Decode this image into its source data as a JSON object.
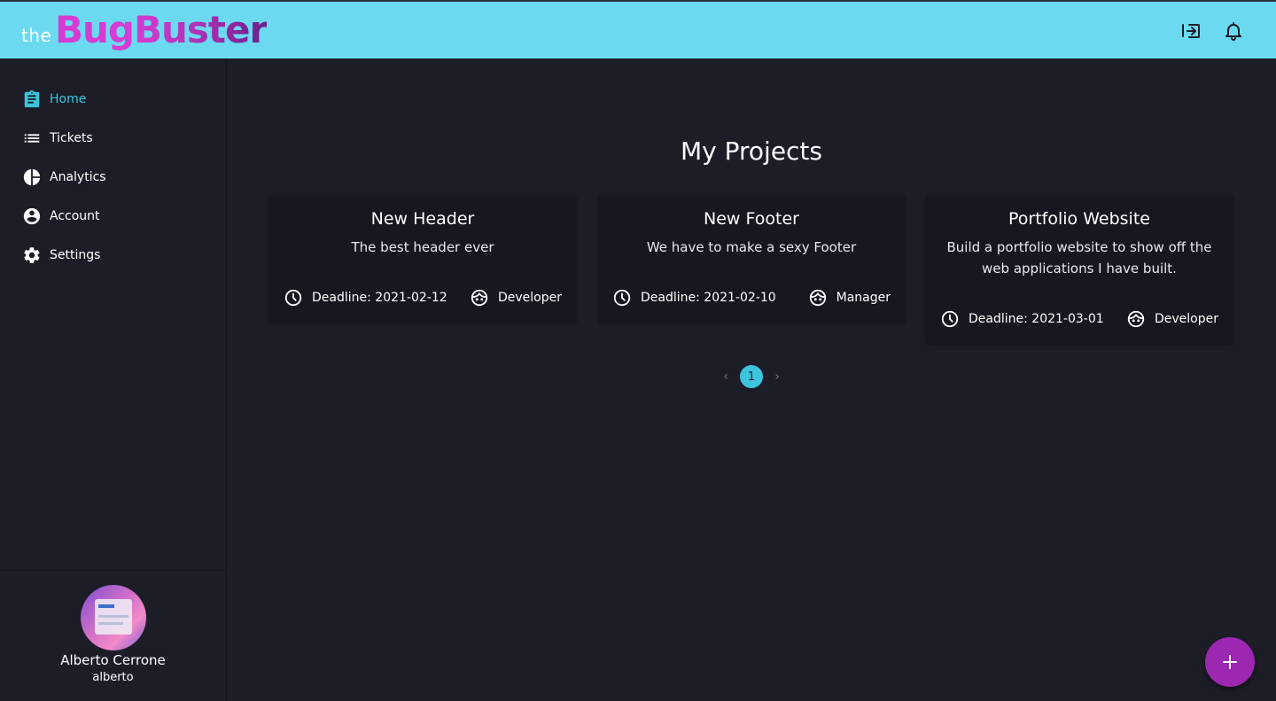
{
  "app": {
    "logo_prefix": "the",
    "logo_part1": "Bug",
    "logo_part2": "Buster"
  },
  "topbar": {
    "icons": [
      "logout-icon",
      "bell-icon"
    ]
  },
  "sidebar": {
    "items": [
      {
        "label": "Home",
        "icon": "assignment-icon",
        "active": true
      },
      {
        "label": "Tickets",
        "icon": "list-icon",
        "active": false
      },
      {
        "label": "Analytics",
        "icon": "pie-chart-icon",
        "active": false
      },
      {
        "label": "Account",
        "icon": "account-circle-icon",
        "active": false
      },
      {
        "label": "Settings",
        "icon": "gear-icon",
        "active": false
      }
    ],
    "user": {
      "name": "Alberto Cerrone",
      "username": "alberto"
    }
  },
  "main": {
    "title": "My Projects",
    "projects": [
      {
        "title": "New Header",
        "description": "The best header ever",
        "deadline": "Deadline: 2021-02-12",
        "role": "Developer"
      },
      {
        "title": "New Footer",
        "description": "We have to make a sexy Footer",
        "deadline": "Deadline: 2021-02-10",
        "role": "Manager"
      },
      {
        "title": "Portfolio Website",
        "description": "Build a portfolio website to show off the web applications I have built.",
        "deadline": "Deadline: 2021-03-01",
        "role": "Developer"
      }
    ],
    "pagination": {
      "current_page": "1",
      "prev_symbol": "‹",
      "next_symbol": "›"
    }
  },
  "colors": {
    "topbar": "#6bdaf0",
    "background": "#1c1d27",
    "card": "#16171f",
    "accent": "#3cc4dc",
    "fab": "#9c27b0",
    "logo_pink": "#d63bd3",
    "logo_purple": "#6b1f8a"
  }
}
